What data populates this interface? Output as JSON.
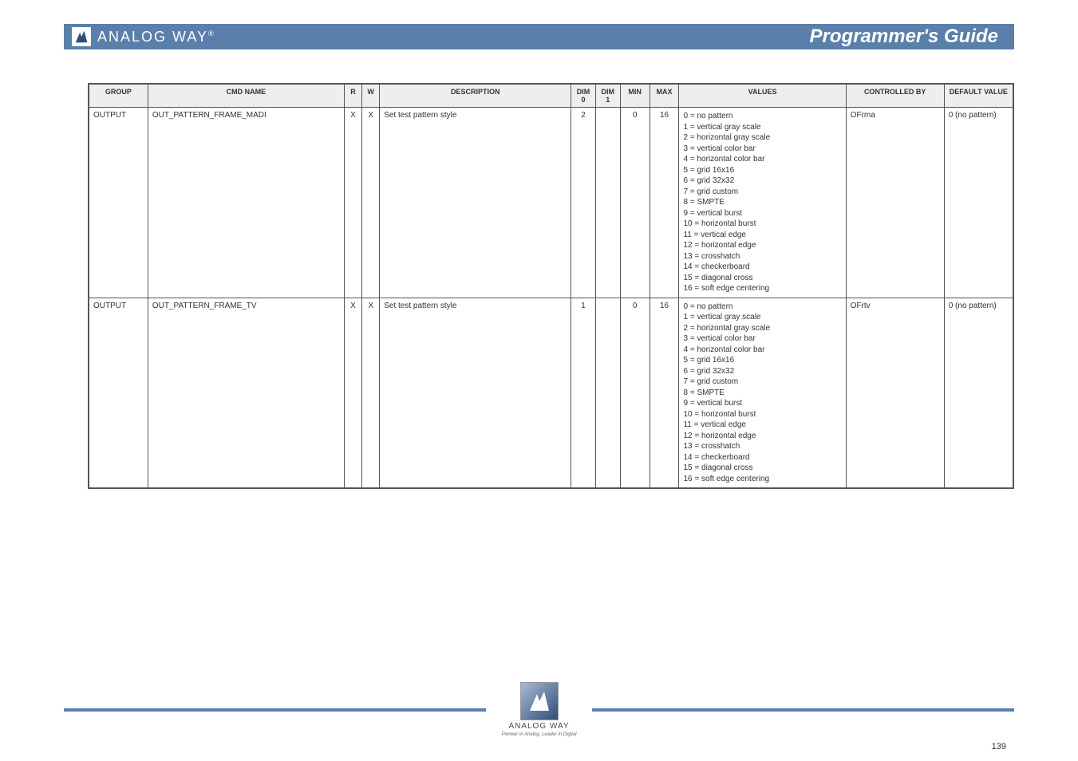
{
  "header": {
    "brand": "ANALOG WAY",
    "title": "Programmer's Guide"
  },
  "table": {
    "headers": [
      "GROUP",
      "CMD NAME",
      "R",
      "W",
      "DESCRIPTION",
      "DIM 0",
      "DIM 1",
      "MIN",
      "MAX",
      "VALUES",
      "CONTROLLED BY",
      "DEFAULT VALUE"
    ],
    "rows": [
      {
        "group": "OUTPUT",
        "cmd": "OUT_PATTERN_FRAME_MADI",
        "r": "X",
        "w": "X",
        "desc": "Set test pattern style",
        "d0": "2",
        "d1": "",
        "min": "0",
        "max": "16",
        "vals": [
          "0 = no pattern",
          "1 = vertical gray scale",
          "2 = horizontal gray scale",
          "3 = vertical color bar",
          "4 = horizontal color bar",
          "5 = grid 16x16",
          "6 = grid 32x32",
          "7 = grid custom",
          "8 = SMPTE",
          "9 = vertical burst",
          "10 = horizontal burst",
          "11 = vertical edge",
          "12 = horizontal edge",
          "13 = crosshatch",
          "14 = checkerboard",
          "15 = diagonal cross",
          "16 = soft edge centering"
        ],
        "ctrl": "OFrma",
        "dflt": "0 (no pattern)"
      },
      {
        "group": "OUTPUT",
        "cmd": "OUT_PATTERN_FRAME_TV",
        "r": "X",
        "w": "X",
        "desc": "Set test pattern style",
        "d0": "1",
        "d1": "",
        "min": "0",
        "max": "16",
        "vals": [
          "0 = no pattern",
          "1 = vertical gray scale",
          "2 = horizontal gray scale",
          "3 = vertical color bar",
          "4 = horizontal color bar",
          "5 = grid 16x16",
          "6 = grid 32x32",
          "7 = grid custom",
          "8 = SMPTE",
          "9 = vertical burst",
          "10 = horizontal burst",
          "11 = vertical edge",
          "12 = horizontal edge",
          "13 = crosshatch",
          "14 = checkerboard",
          "15 = diagonal cross",
          "16 = soft edge centering"
        ],
        "ctrl": "OFrtv",
        "dflt": "0 (no pattern)"
      }
    ]
  },
  "footer": {
    "brand": "ANALOG WAY",
    "tag": "Pioneer in Analog, Leader in Digital",
    "page": "139"
  }
}
